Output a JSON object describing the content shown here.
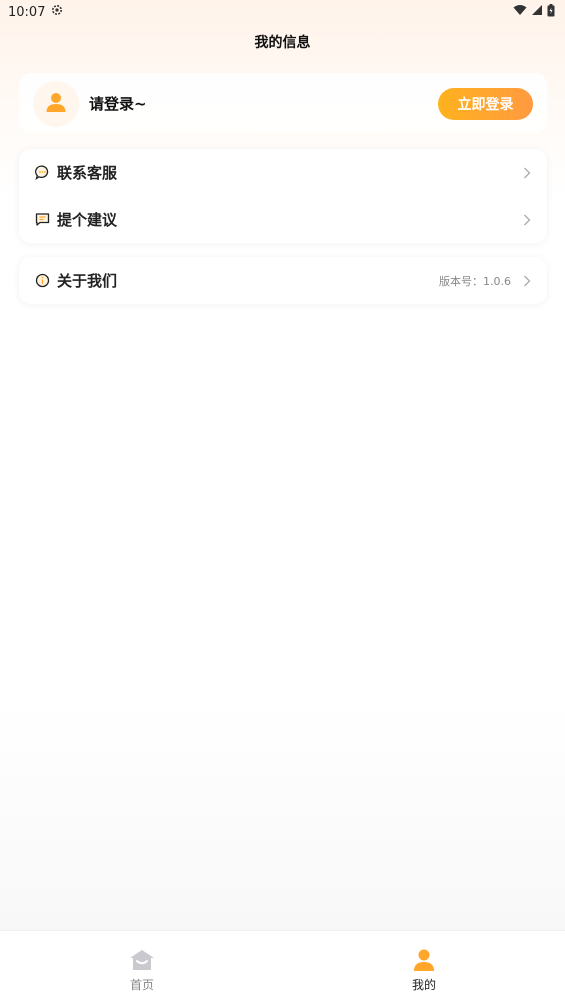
{
  "status_bar": {
    "time": "10:07"
  },
  "header": {
    "title": "我的信息"
  },
  "login": {
    "prompt": "请登录~",
    "button_label": "立即登录"
  },
  "menu": {
    "contact": {
      "label": "联系客服"
    },
    "suggest": {
      "label": "提个建议"
    },
    "about": {
      "label": "关于我们",
      "version_text": "版本号：1.0.6"
    }
  },
  "tab_bar": {
    "home": {
      "label": "首页"
    },
    "mine": {
      "label": "我的"
    }
  },
  "colors": {
    "accent": "#ffa62b",
    "accent_end": "#ff9a40"
  }
}
